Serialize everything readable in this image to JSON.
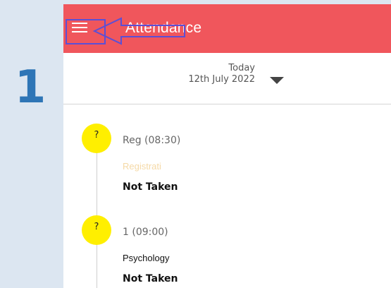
{
  "step": {
    "number": "1",
    "color": "#2e75b6"
  },
  "appbar": {
    "title": "Attendance",
    "menu_icon": "hamburger-menu-icon",
    "background": "#f0565c"
  },
  "annotation": {
    "color": "#5b4fd6",
    "arrow_icon": "left-arrow-icon"
  },
  "date_selector": {
    "label": "Today",
    "date": "12th July 2022",
    "dropdown_icon": "caret-down-icon"
  },
  "periods": [
    {
      "marker": "?",
      "time": "Reg (08:30)",
      "subject": "Registrati",
      "subject_color": "#f5d9a6",
      "status": "Not Taken"
    },
    {
      "marker": "?",
      "time": "1 (09:00)",
      "subject": "Psychology",
      "subject_color": "#111111",
      "status": "Not Taken"
    }
  ],
  "marker_color": "#ffef00"
}
